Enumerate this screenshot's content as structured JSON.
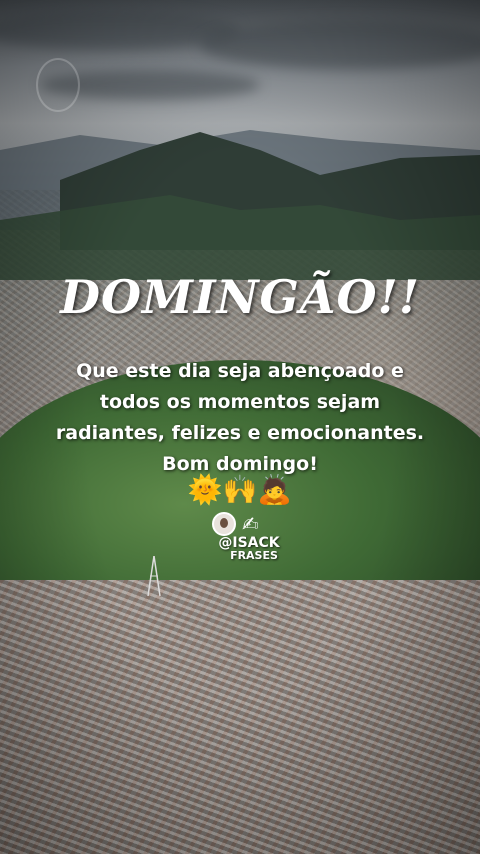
{
  "post": {
    "title": "DOMINGÃO!!",
    "message": "Que este dia seja abençoado e todos os momentos sejam radiantes, felizes e emocionantes. Bom domingo!",
    "emojis": "🌞🙌🙇"
  },
  "credit": {
    "handle": "@ISACK",
    "subtitle": "FRASES",
    "avatar_icon": "person-avatar",
    "writing_icon": "writing-hand-icon"
  },
  "background": {
    "description_icon": "aerial-city-photo",
    "colors": {
      "sky": "#9aa0a5",
      "hill": "#3f6a35",
      "city": "#8a8480"
    }
  }
}
